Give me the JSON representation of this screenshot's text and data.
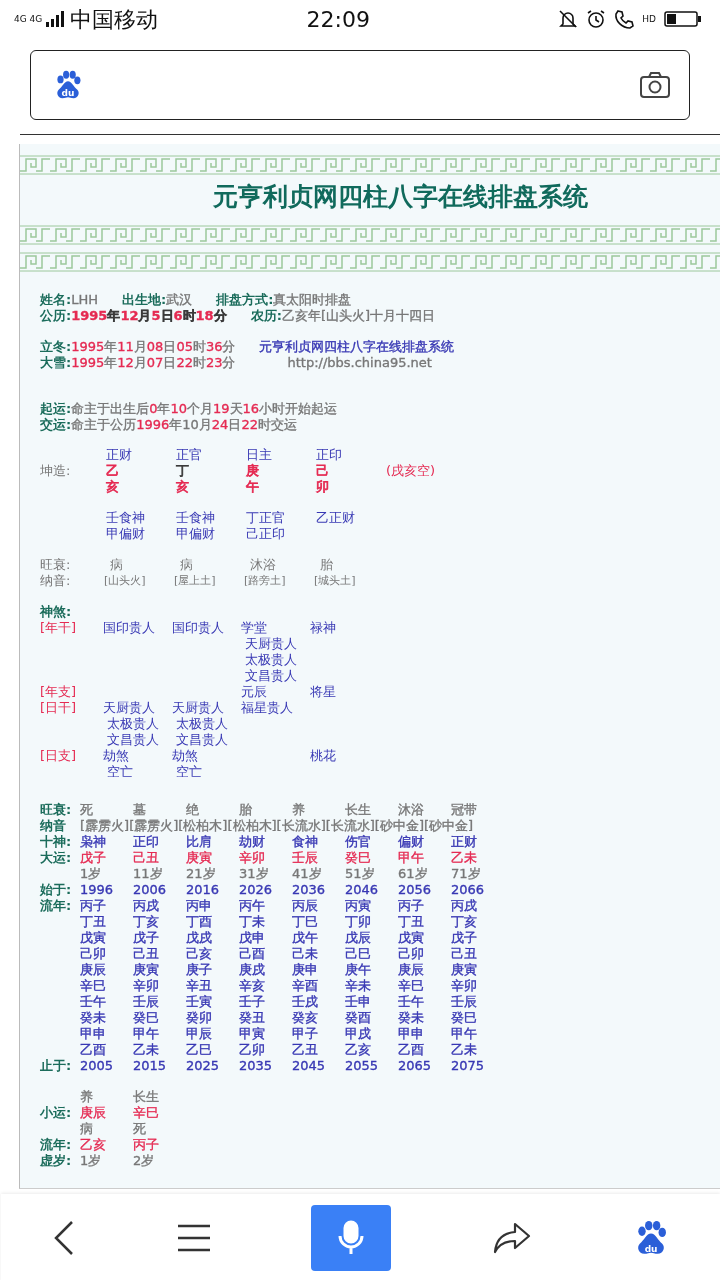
{
  "status_bar": {
    "network": "4G 4G",
    "carrier": "中国移动",
    "time": "22:09",
    "hd": "HD"
  },
  "browser": {
    "logo_text": "du"
  },
  "title": "元亨利贞网四柱八字在线排盘系统",
  "info_blocks": [
    [
      [
        {
          "kind": "field",
          "label": "姓名:",
          "value": [
            {
              "text": "LHH",
              "color": "#777777"
            }
          ]
        },
        {
          "kind": "field",
          "label": "出生地:",
          "value": [
            {
              "text": "武汉",
              "color": "#777777"
            }
          ]
        },
        {
          "kind": "field",
          "label": "排盘方式:",
          "value": [
            {
              "text": "真太阳时排盘",
              "color": "#777777"
            }
          ]
        }
      ],
      [
        {
          "kind": "field",
          "label": "公历:",
          "bold": true,
          "value": [
            {
              "text": "1995",
              "color": "#e52a52"
            },
            {
              "text": "年",
              "color": "#3a3a3a"
            },
            {
              "text": "12",
              "color": "#e52a52"
            },
            {
              "text": "月",
              "color": "#3a3a3a"
            },
            {
              "text": "5",
              "color": "#e52a52"
            },
            {
              "text": "日",
              "color": "#3a3a3a"
            },
            {
              "text": "6",
              "color": "#e52a52"
            },
            {
              "text": "时",
              "color": "#3a3a3a"
            },
            {
              "text": "18",
              "color": "#e52a52"
            },
            {
              "text": "分",
              "color": "#3a3a3a"
            }
          ]
        },
        {
          "kind": "field",
          "label": "农历:",
          "value": [
            {
              "text": "乙亥年[山头火]十月十四日",
              "color": "#777777"
            }
          ]
        }
      ]
    ],
    [
      [
        {
          "kind": "field",
          "label": "立冬:",
          "value": [
            {
              "text": "1995",
              "color": "#e52a52"
            },
            {
              "text": "年",
              "color": "#777777"
            },
            {
              "text": "11",
              "color": "#e52a52"
            },
            {
              "text": "月",
              "color": "#777777"
            },
            {
              "text": "08",
              "color": "#e52a52"
            },
            {
              "text": "日",
              "color": "#777777"
            },
            {
              "text": "05",
              "color": "#e52a52"
            },
            {
              "text": "时",
              "color": "#777777"
            },
            {
              "text": "36",
              "color": "#e52a52"
            },
            {
              "text": "分",
              "color": "#777777"
            }
          ]
        },
        {
          "kind": "link",
          "value": [
            {
              "text": "元亨利贞网四柱八字在线排盘系统",
              "color": "#3838b4"
            }
          ]
        }
      ],
      [
        {
          "kind": "field",
          "label": "大雪:",
          "value": [
            {
              "text": "1995",
              "color": "#e52a52"
            },
            {
              "text": "年",
              "color": "#777777"
            },
            {
              "text": "12",
              "color": "#e52a52"
            },
            {
              "text": "月",
              "color": "#777777"
            },
            {
              "text": "07",
              "color": "#e52a52"
            },
            {
              "text": "日",
              "color": "#777777"
            },
            {
              "text": "22",
              "color": "#e52a52"
            },
            {
              "text": "时",
              "color": "#777777"
            },
            {
              "text": "23",
              "color": "#e52a52"
            },
            {
              "text": "分",
              "color": "#777777"
            }
          ]
        },
        {
          "kind": "url",
          "value": [
            {
              "text": "http://bbs.china95.net",
              "color": "#777777"
            }
          ]
        }
      ]
    ],
    [
      [
        {
          "kind": "field",
          "label": "起运:",
          "value": [
            {
              "text": "命主于出生后",
              "color": "#777777"
            },
            {
              "text": "0",
              "color": "#e52a52"
            },
            {
              "text": "年",
              "color": "#777777"
            },
            {
              "text": "10",
              "color": "#e52a52"
            },
            {
              "text": "个月",
              "color": "#777777"
            },
            {
              "text": "19",
              "color": "#e52a52"
            },
            {
              "text": "天",
              "color": "#777777"
            },
            {
              "text": "16",
              "color": "#e52a52"
            },
            {
              "text": "小时开始起运",
              "color": "#777777"
            }
          ]
        }
      ],
      [
        {
          "kind": "field",
          "label": "交运:",
          "value": [
            {
              "text": "命主于公历",
              "color": "#777777"
            },
            {
              "text": "1996",
              "color": "#e52a52"
            },
            {
              "text": "年10月",
              "color": "#777777"
            },
            {
              "text": "24",
              "color": "#e52a52"
            },
            {
              "text": "日",
              "color": "#777777"
            },
            {
              "text": "22",
              "color": "#e52a52"
            },
            {
              "text": "时交运",
              "color": "#777777"
            }
          ]
        }
      ]
    ]
  ],
  "pillars": {
    "label": "坤造:",
    "gods": [
      "正财",
      "正官",
      "日主",
      "正印"
    ],
    "stems": [
      {
        "text": "乙",
        "color": "#e52a52"
      },
      {
        "text": "丁",
        "color": "#3a3a3a"
      },
      {
        "text": "庚",
        "color": "#e52a52"
      },
      {
        "text": "己",
        "color": "#e52a52"
      }
    ],
    "branches": [
      {
        "text": "亥",
        "color": "#e52a52"
      },
      {
        "text": "亥",
        "color": "#e52a52"
      },
      {
        "text": "午",
        "color": "#e52a52"
      },
      {
        "text": "卯",
        "color": "#e52a52"
      }
    ],
    "void": "(戌亥空)",
    "hidden": [
      [
        "壬食神",
        "甲偏财"
      ],
      [
        "壬食神",
        "甲偏财"
      ],
      [
        "丁正官",
        "己正印"
      ],
      [
        "乙正财"
      ]
    ],
    "strength_label": "旺衰:",
    "strength": [
      "病",
      "病",
      "沐浴",
      "胎"
    ],
    "nayin_label": "纳音:",
    "nayin": [
      "[山头火]",
      "[屋上土]",
      "[路旁土]",
      "[城头土]"
    ]
  },
  "shensha": {
    "title": "神煞:",
    "rows": [
      {
        "label": "[年干]",
        "cells": [
          [
            "国印贵人"
          ],
          [
            "国印贵人"
          ],
          [
            "学堂",
            "天厨贵人",
            "太极贵人",
            "文昌贵人"
          ],
          [
            "禄神"
          ]
        ]
      },
      {
        "label": "[年支]",
        "cells": [
          [],
          [],
          [
            "元辰"
          ],
          [
            "将星"
          ]
        ]
      },
      {
        "label": "[日干]",
        "cells": [
          [
            "天厨贵人",
            "太极贵人",
            "文昌贵人"
          ],
          [
            "天厨贵人",
            "太极贵人",
            "文昌贵人"
          ],
          [
            "福星贵人"
          ],
          []
        ]
      },
      {
        "label": "[日支]",
        "cells": [
          [
            "劫煞",
            "空亡"
          ],
          [
            "劫煞",
            "空亡"
          ],
          [],
          [
            "桃花"
          ]
        ]
      }
    ]
  },
  "dayun": [
    {
      "kind": "cells",
      "label": "旺衰:",
      "color": "#777777",
      "cells": [
        "死",
        "墓",
        "绝",
        "胎",
        "养",
        "长生",
        "沐浴",
        "冠带"
      ]
    },
    {
      "kind": "run",
      "label": "纳音",
      "color": "#777777",
      "text": "[霹雳火][霹雳火][松柏木][松柏木][长流水][长流水][砂中金][砂中金]"
    },
    {
      "kind": "cells",
      "label": "十神:",
      "color": "#3838b4",
      "cells": [
        "枭神",
        "正印",
        "比肩",
        "劫财",
        "食神",
        "伤官",
        "偏财",
        "正财"
      ]
    },
    {
      "kind": "cells",
      "label": "大运:",
      "color": "#e52a52",
      "cells": [
        "戊子",
        "己丑",
        "庚寅",
        "辛卯",
        "壬辰",
        "癸巳",
        "甲午",
        "乙未"
      ]
    },
    {
      "kind": "cells",
      "color": "#777777",
      "cells": [
        "1岁",
        "11岁",
        "21岁",
        "31岁",
        "41岁",
        "51岁",
        "61岁",
        "71岁"
      ]
    },
    {
      "kind": "cells",
      "label": "始于:",
      "color": "#3838b4",
      "cells": [
        "1996",
        "2006",
        "2016",
        "2026",
        "2036",
        "2046",
        "2056",
        "2066"
      ]
    },
    {
      "kind": "cells",
      "label": "流年:",
      "color": "#3838b4",
      "cells": [
        "丙子",
        "丙戌",
        "丙申",
        "丙午",
        "丙辰",
        "丙寅",
        "丙子",
        "丙戌"
      ]
    },
    {
      "kind": "cells",
      "color": "#3838b4",
      "cells": [
        "丁丑",
        "丁亥",
        "丁酉",
        "丁未",
        "丁巳",
        "丁卯",
        "丁丑",
        "丁亥"
      ]
    },
    {
      "kind": "cells",
      "color": "#3838b4",
      "cells": [
        "戊寅",
        "戊子",
        "戊戌",
        "戊申",
        "戊午",
        "戊辰",
        "戊寅",
        "戊子"
      ]
    },
    {
      "kind": "cells",
      "color": "#3838b4",
      "cells": [
        "己卯",
        "己丑",
        "己亥",
        "己酉",
        "己未",
        "己巳",
        "己卯",
        "己丑"
      ]
    },
    {
      "kind": "cells",
      "color": "#3838b4",
      "cells": [
        "庚辰",
        "庚寅",
        "庚子",
        "庚戌",
        "庚申",
        "庚午",
        "庚辰",
        "庚寅"
      ]
    },
    {
      "kind": "cells",
      "color": "#3838b4",
      "cells": [
        "辛巳",
        "辛卯",
        "辛丑",
        "辛亥",
        "辛酉",
        "辛未",
        "辛巳",
        "辛卯"
      ]
    },
    {
      "kind": "cells",
      "color": "#3838b4",
      "cells": [
        "壬午",
        "壬辰",
        "壬寅",
        "壬子",
        "壬戌",
        "壬申",
        "壬午",
        "壬辰"
      ]
    },
    {
      "kind": "cells",
      "color": "#3838b4",
      "cells": [
        "癸未",
        "癸巳",
        "癸卯",
        "癸丑",
        "癸亥",
        "癸酉",
        "癸未",
        "癸巳"
      ]
    },
    {
      "kind": "cells",
      "color": "#3838b4",
      "cells": [
        "甲申",
        "甲午",
        "甲辰",
        "甲寅",
        "甲子",
        "甲戌",
        "甲申",
        "甲午"
      ]
    },
    {
      "kind": "cells",
      "color": "#3838b4",
      "cells": [
        "乙酉",
        "乙未",
        "乙巳",
        "乙卯",
        "乙丑",
        "乙亥",
        "乙酉",
        "乙未"
      ]
    },
    {
      "kind": "cells",
      "label": "止于:",
      "color": "#3838b4",
      "cells": [
        "2005",
        "2015",
        "2025",
        "2035",
        "2045",
        "2055",
        "2065",
        "2075"
      ]
    }
  ],
  "xiaoyun": [
    {
      "kind": "cells",
      "color": "#777777",
      "cells": [
        "养",
        "长生"
      ]
    },
    {
      "kind": "cells",
      "label": "小运:",
      "color": "#e52a52",
      "cells": [
        "庚辰",
        "辛巳"
      ]
    },
    {
      "kind": "cells",
      "color": "#777777",
      "cells": [
        "病",
        "死"
      ]
    },
    {
      "kind": "cells",
      "label": "流年:",
      "color": "#e52a52",
      "cells": [
        "乙亥",
        "丙子"
      ]
    },
    {
      "kind": "cells",
      "label": "虚岁:",
      "color": "#777777",
      "cells": [
        "1岁",
        "2岁"
      ]
    }
  ],
  "bottom_nav": {
    "logo_text": "du"
  }
}
